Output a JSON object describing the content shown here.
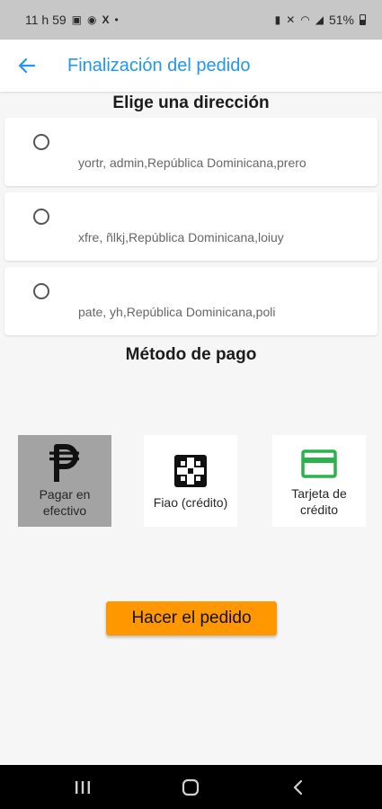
{
  "status_bar": {
    "time": "11 h 59",
    "battery": "51%"
  },
  "app_bar": {
    "title": "Finalización del pedido",
    "back_icon": "arrow-back-icon"
  },
  "address_section": {
    "title": "Elige una dirección",
    "addresses": [
      {
        "text": "yortr, admin,República Dominicana,prero",
        "selected": false
      },
      {
        "text": "xfre, ñlkj,República Dominicana,loiuy",
        "selected": false
      },
      {
        "text": "pate, yh,República Dominicana,poli",
        "selected": false
      }
    ]
  },
  "payment_section": {
    "title": "Método de pago",
    "options": [
      {
        "label_line1": "Pagar en",
        "label_line2": "efectivo",
        "icon": "peso-sign-icon",
        "selected": true
      },
      {
        "label_line1": "Fiao (crédito)",
        "label_line2": "",
        "icon": "credit-box-icon",
        "selected": false
      },
      {
        "label_line1": "Tarjeta de",
        "label_line2": "crédito",
        "icon": "credit-card-icon",
        "selected": false
      }
    ]
  },
  "order_button": {
    "label": "Hacer el pedido"
  },
  "nav_bar": {
    "icons": [
      "recents-icon",
      "home-icon",
      "back-icon"
    ]
  },
  "colors": {
    "primary": "#2196f3",
    "accent": "#ff9800",
    "card_icon": "#2bb24c",
    "selected_bg": "#a3a3a3"
  }
}
